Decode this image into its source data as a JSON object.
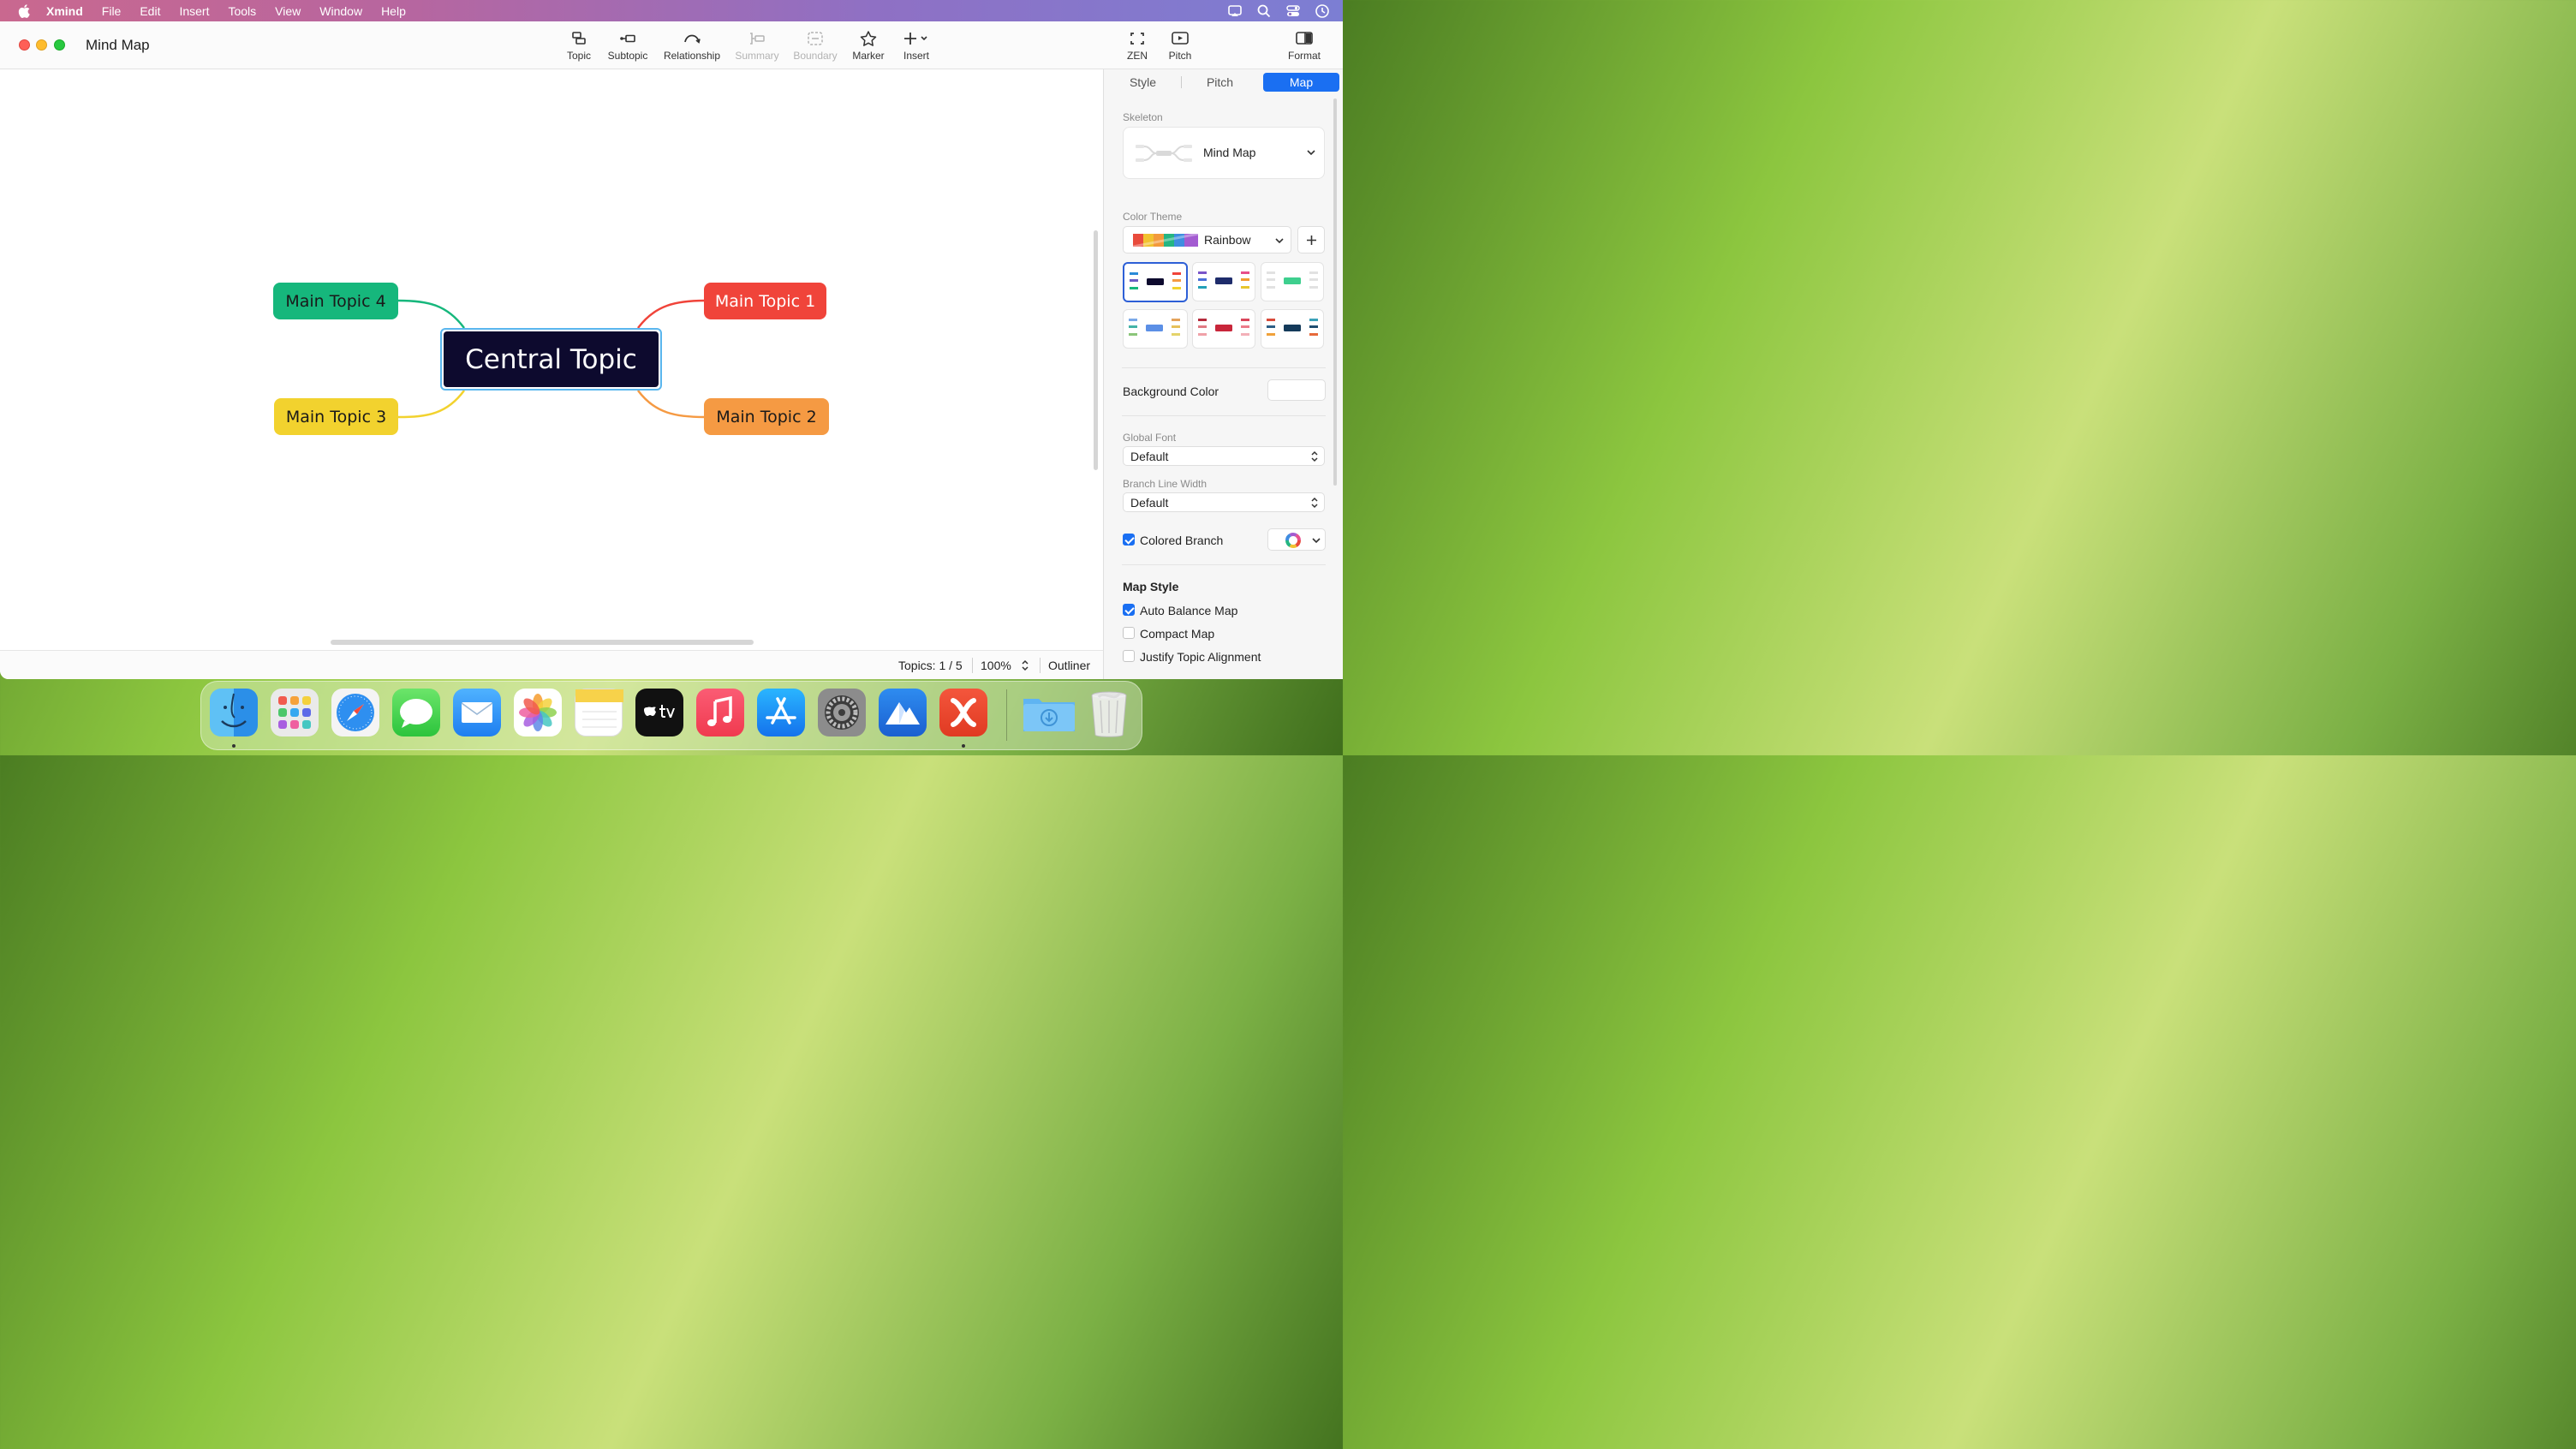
{
  "menubar": {
    "app_name": "Xmind",
    "items": [
      "File",
      "Edit",
      "Insert",
      "Tools",
      "View",
      "Window",
      "Help"
    ]
  },
  "window": {
    "title": "Mind Map"
  },
  "toolbar": {
    "topic": "Topic",
    "subtopic": "Subtopic",
    "relationship": "Relationship",
    "summary": "Summary",
    "boundary": "Boundary",
    "marker": "Marker",
    "insert": "Insert",
    "zen": "ZEN",
    "pitch": "Pitch",
    "format": "Format"
  },
  "mindmap": {
    "central": "Central Topic",
    "topics": [
      {
        "label": "Main Topic 1",
        "color": "#f0443a"
      },
      {
        "label": "Main Topic 2",
        "color": "#f59a43"
      },
      {
        "label": "Main Topic 3",
        "color": "#f2d22e"
      },
      {
        "label": "Main Topic 4",
        "color": "#16b77c"
      }
    ]
  },
  "status": {
    "topics": "Topics: 1 / 5",
    "zoom": "100%",
    "outliner": "Outliner"
  },
  "panel": {
    "tabs": [
      "Style",
      "Pitch",
      "Map"
    ],
    "active_tab": "Map",
    "skeleton_label": "Skeleton",
    "skeleton_value": "Mind Map",
    "color_theme_label": "Color Theme",
    "color_theme_value": "Rainbow",
    "background_color_label": "Background Color",
    "global_font_label": "Global Font",
    "global_font_value": "Default",
    "branch_line_width_label": "Branch Line Width",
    "branch_line_width_value": "Default",
    "colored_branch_label": "Colored Branch",
    "colored_branch_checked": true,
    "map_style_title": "Map Style",
    "auto_balance_label": "Auto Balance Map",
    "auto_balance_checked": true,
    "compact_map_label": "Compact Map",
    "compact_map_checked": false,
    "justify_label": "Justify Topic Alignment",
    "justify_checked": false
  },
  "colors": {
    "accent": "#1a6ff2",
    "central_fill": "#0d0a2e",
    "selection": "#5ab6ee"
  },
  "dock": {
    "apps": [
      "finder-icon",
      "launchpad-icon",
      "safari-icon",
      "messages-icon",
      "mail-icon",
      "photos-icon",
      "notes-icon",
      "apple-tv-icon",
      "music-icon",
      "app-store-icon",
      "system-settings-icon",
      "mountain-app-icon",
      "xmind-icon",
      "downloads-folder-icon",
      "trash-icon"
    ]
  }
}
